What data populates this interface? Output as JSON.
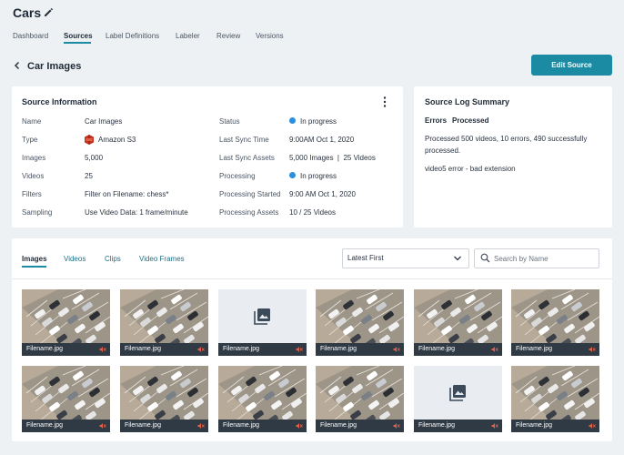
{
  "app": {
    "title": "Cars"
  },
  "nav": {
    "tabs": [
      "Dashboard",
      "Sources",
      "Label Definitions",
      "Labeler",
      "Review",
      "Versions"
    ],
    "active": "Sources"
  },
  "page": {
    "title": "Car Images",
    "edit_button": "Edit Source"
  },
  "source_info": {
    "title": "Source Information",
    "left": [
      {
        "label": "Name",
        "value": "Car Images"
      },
      {
        "label": "Type",
        "value": "Amazon S3"
      },
      {
        "label": "Images",
        "value": "5,000"
      },
      {
        "label": "Videos",
        "value": "25"
      },
      {
        "label": "Filters",
        "value": "Filter on Filename: chess*"
      },
      {
        "label": "Sampling",
        "value": "Use Video Data: 1 frame/minute"
      }
    ],
    "right": [
      {
        "label": "Status",
        "value": "In progress"
      },
      {
        "label": "Last Sync Time",
        "value": "9:00AM Oct 1, 2020"
      },
      {
        "label": "Last Sync Assets",
        "value": "5,000 Images  |  25 Videos"
      },
      {
        "label": "Processing",
        "value": "In progress"
      },
      {
        "label": "Processing Started",
        "value": "9:00 AM Oct 1, 2020"
      },
      {
        "label": "Processing Assets",
        "value": "10 / 25 Videos"
      }
    ]
  },
  "source_log": {
    "title": "Source Log Summary",
    "tabs": [
      "Errors",
      "Processed"
    ],
    "message_line1": "Processed 500 videos, 10 errors, 490 successfully",
    "message_line2": "processed.",
    "error": "video5 error - bad extension"
  },
  "gallery": {
    "tabs": [
      "Images",
      "Videos",
      "Clips",
      "Video Frames"
    ],
    "active": "Images",
    "sort_value": "Latest First",
    "search_placeholder": "Search by Name",
    "items": [
      {
        "filename": "Filename.jpg",
        "kind": "photo"
      },
      {
        "filename": "Filename.jpg",
        "kind": "photo"
      },
      {
        "filename": "Filename.jpg",
        "kind": "placeholder"
      },
      {
        "filename": "Filename.jpg",
        "kind": "photo"
      },
      {
        "filename": "Filename.jpg",
        "kind": "photo"
      },
      {
        "filename": "Filename.jpg",
        "kind": "photo"
      },
      {
        "filename": "Filename.jpg",
        "kind": "photo"
      },
      {
        "filename": "Filename.jpg",
        "kind": "photo"
      },
      {
        "filename": "Filename.jpg",
        "kind": "photo"
      },
      {
        "filename": "Filename.jpg",
        "kind": "photo"
      },
      {
        "filename": "Filename.jpg",
        "kind": "placeholder"
      },
      {
        "filename": "Filename.jpg",
        "kind": "photo"
      }
    ]
  },
  "colors": {
    "accent": "#1b8ba3",
    "status_dot": "#2b8fe0",
    "aws_red": "#c7331d",
    "caption_bg": "#2f3a45"
  },
  "icons": [
    "edit-icon",
    "chevron-left-icon",
    "kebab-icon",
    "aws-s3-icon",
    "chevron-down-icon",
    "search-icon",
    "image-placeholder-icon",
    "muted-speaker-icon"
  ]
}
